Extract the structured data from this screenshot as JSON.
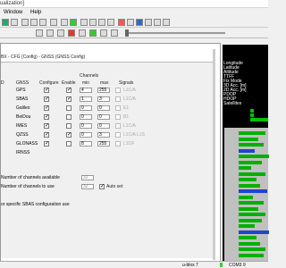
{
  "window": {
    "title": "ualization]"
  },
  "menu": [
    "Window",
    "Help"
  ],
  "config": {
    "title": "BX - CFG (Config) - GNSS (GNSS Config)",
    "headers": {
      "gnss": "GNSS",
      "configure": "Configure",
      "enable": "Enable",
      "channels": "Channels",
      "min": "min",
      "max": "max",
      "signals": "Signals"
    },
    "rows": [
      {
        "name": "GPS",
        "configure": true,
        "enable": true,
        "min": "4",
        "max": "255",
        "signals": "L1C/A"
      },
      {
        "name": "SBAS",
        "configure": true,
        "enable": true,
        "min": "1",
        "max": "3",
        "signals": "L1C/A"
      },
      {
        "name": "Galileo",
        "configure": true,
        "enable": false,
        "min": "0",
        "max": "0",
        "signals": "E1"
      },
      {
        "name": "BeiDou",
        "configure": true,
        "enable": false,
        "min": "0",
        "max": "0",
        "signals": "B1"
      },
      {
        "name": "IMES",
        "configure": true,
        "enable": false,
        "min": "0",
        "max": "0",
        "signals": "L1C/A"
      },
      {
        "name": "QZSS",
        "configure": true,
        "enable": true,
        "min": "0",
        "max": "3",
        "signals": "L1C/A    L1S"
      },
      {
        "name": "GLONASS",
        "configure": true,
        "enable": false,
        "min": "8",
        "max": "255",
        "signals": "L1OF"
      },
      {
        "name": "IRNSS",
        "configure": false,
        "enable": false,
        "min": "",
        "max": "",
        "signals": ""
      }
    ],
    "channels_available_label": "Number of channels available",
    "channels_available": "32",
    "channels_use_label": "Number of channels to use",
    "channels_use": "32",
    "auto_set_label": "Auto set",
    "sbas_note": "or specific SBAS configuration use"
  },
  "sidebar": [
    "Longitude",
    "Latitude",
    "Altitude",
    "TTFF",
    "Fix Mode",
    "3D Acc. [m]",
    "2D Acc. [m]",
    "PDOP",
    "HDOP",
    "Satellites"
  ],
  "status": {
    "device": "u-blox 7",
    "port": "COM3 9"
  },
  "colors": {
    "accent": "#00c000",
    "sidebar_bg": "#000000"
  }
}
